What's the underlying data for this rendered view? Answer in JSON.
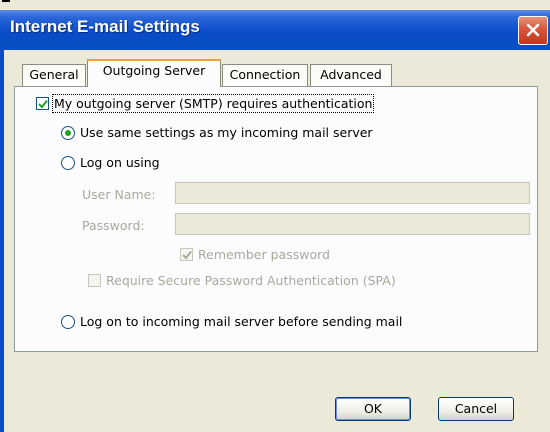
{
  "window": {
    "title": "Internet E-mail Settings"
  },
  "tabs": [
    {
      "label": "General"
    },
    {
      "label": "Outgoing Server",
      "active": true
    },
    {
      "label": "Connection"
    },
    {
      "label": "Advanced"
    }
  ],
  "outgoing": {
    "smtp_auth": {
      "label": "My outgoing server (SMTP) requires authentication",
      "checked": true
    },
    "use_same": {
      "label": "Use same settings as my incoming mail server",
      "selected": true
    },
    "log_on_using": {
      "label": "Log on using",
      "selected": false
    },
    "user_name_label": "User Name:",
    "user_name_value": "",
    "password_label": "Password:",
    "password_value": "",
    "remember_password": {
      "label": "Remember password",
      "checked": true,
      "enabled": false
    },
    "require_spa": {
      "label": "Require Secure Password Authentication (SPA)",
      "checked": false,
      "enabled": false
    },
    "log_on_incoming": {
      "label": "Log on to incoming mail server before sending mail",
      "selected": false
    }
  },
  "buttons": {
    "ok": "OK",
    "cancel": "Cancel"
  },
  "colors": {
    "titlebar": "#0a4bc9",
    "close_button": "#d8553a",
    "dialog_bg": "#ece9d8",
    "radio_dot": "#21a121",
    "active_tab_accent": "#f0a03c"
  }
}
